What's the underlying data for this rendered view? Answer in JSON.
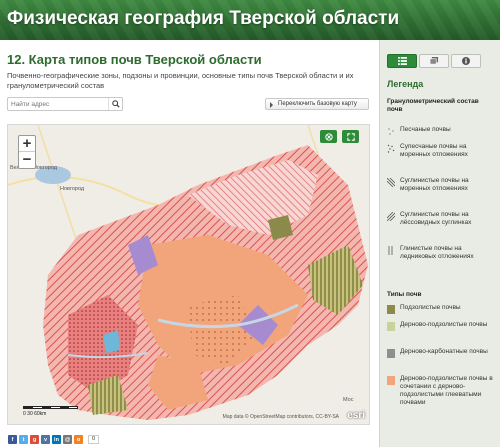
{
  "header": {
    "title": "Физическая география Тверской области"
  },
  "main": {
    "title": "12. Карта типов почв Тверской области",
    "subtitle": "Почвенно-географические зоны, подзоны и провинции, основные типы почв Тверской области и их гранулометрический состав",
    "search_placeholder": "Найти адрес",
    "basemap_button": "Переключить базовую карту"
  },
  "map": {
    "cities": [
      "Великий Новгород",
      "Новгород",
      "Мос"
    ],
    "attribution": "Map data © OpenStreetMap contributors, CC-BY-SA",
    "logo": "esri",
    "scale_labels": "0      30      60km",
    "zoom_in": "+",
    "zoom_out": "−"
  },
  "share": {
    "count": "0"
  },
  "sidebar": {
    "legend_title": "Легенда",
    "sections": [
      {
        "heading": "Гранулометрический состав почв",
        "items": [
          {
            "label": "Песчаные почвы",
            "pattern": "dots"
          },
          {
            "label": "Супесчаные почвы на моренных отложениях",
            "pattern": "dots2"
          },
          {
            "label": "Суглинистые почвы на моренных отложениях",
            "pattern": "hatch"
          },
          {
            "label": "Суглинистые почвы на лёссовидных суглинках",
            "pattern": "hatch2"
          },
          {
            "label": "Глинистые почвы на ледниковых отложениях",
            "pattern": "vert"
          }
        ]
      },
      {
        "heading": "Типы почв",
        "items": [
          {
            "label": "Подзолистые почвы",
            "color": "#8a8a4a"
          },
          {
            "label": "Дерново-подзолистые почвы",
            "color": "#c9d29a"
          },
          {
            "label": "Дерново-карбонатные почвы",
            "color": "#8f8f8f"
          },
          {
            "label": "Дерново-подзолистые почвы в сочетании с дерново-подзолистыми глееватыми почвами",
            "color": "#f2a57a"
          }
        ]
      }
    ]
  }
}
